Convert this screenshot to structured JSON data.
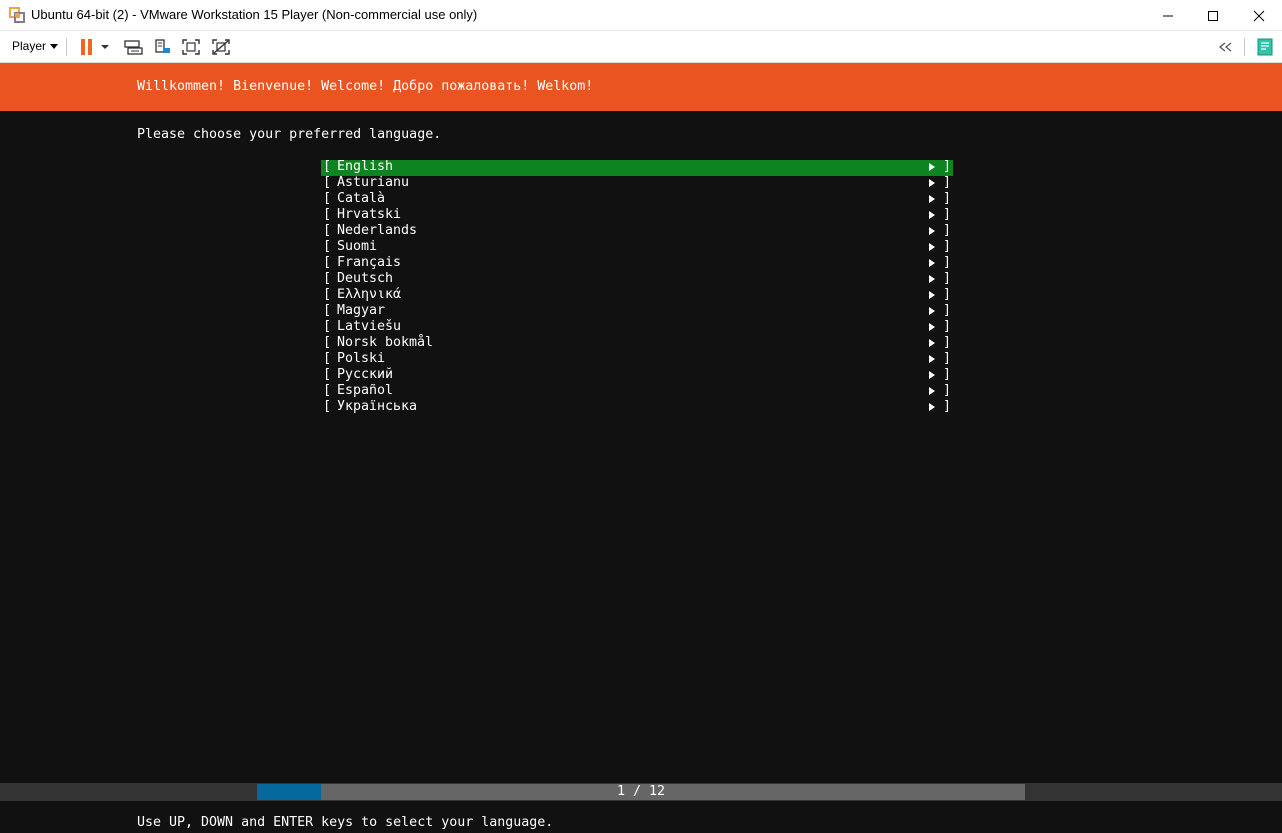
{
  "window": {
    "title": "Ubuntu 64-bit (2) - VMware Workstation 15 Player (Non-commercial use only)",
    "controls": [
      "minimize-icon",
      "maximize-icon",
      "close-icon"
    ]
  },
  "toolbar": {
    "player_label": "Player",
    "icons": [
      "pause-icon",
      "send-ctrl-alt-del-icon",
      "removable-devices-icon",
      "fullscreen-icon",
      "unity-icon",
      "collapse-toolbar-icon",
      "notes-icon"
    ]
  },
  "colors": {
    "header": "#e95420",
    "selected": "#0e8420",
    "progress_fill": "#06699b",
    "progress_track": "#666666",
    "pause_accent": "#f26522"
  },
  "installer": {
    "header_text": "Willkommen! Bienvenue! Welcome! Добро пожаловать! Welkom!",
    "prompt": "Please choose your preferred language.",
    "bracket_open": "[",
    "bracket_close": "]",
    "selected_index": 0,
    "languages": [
      "English",
      "Asturianu",
      "Català",
      "Hrvatski",
      "Nederlands",
      "Suomi",
      "Français",
      "Deutsch",
      "Ελληνικά",
      "Magyar",
      "Latviešu",
      "Norsk bokmål",
      "Polski",
      "Русский",
      "Español",
      "Українська"
    ],
    "progress": {
      "text": "1 / 12",
      "current": 1,
      "total": 12
    },
    "help_text": "Use UP, DOWN and ENTER keys to select your language."
  }
}
